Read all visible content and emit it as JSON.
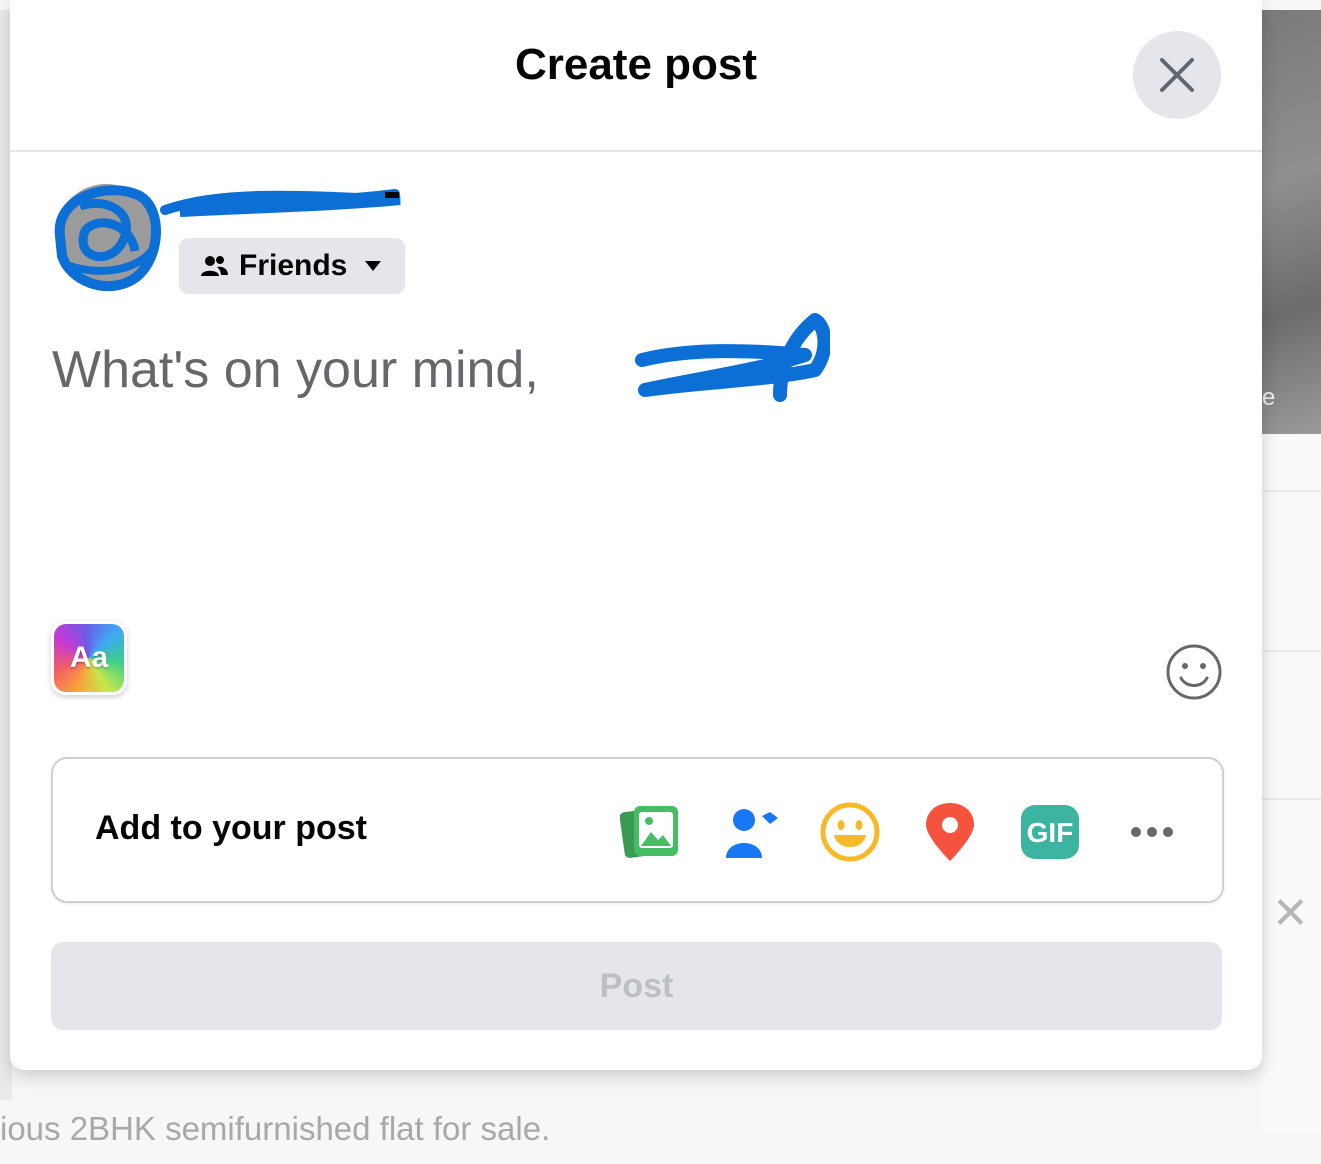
{
  "modal": {
    "title": "Create post",
    "close_label": "Close"
  },
  "user": {
    "audience": "Friends"
  },
  "composer": {
    "placeholder": "What's on your mind,"
  },
  "add_to_post": {
    "label": "Add to your post",
    "icons": [
      "photo-video-icon",
      "tag-people-icon",
      "feeling-activity-icon",
      "check-in-icon",
      "gif-icon",
      "more-icon"
    ]
  },
  "post_button": {
    "label": "Post"
  },
  "text_format": {
    "label": "Aa"
  },
  "background_page": {
    "text": "ious 2BHK semifurnished flat for sale."
  },
  "colors": {
    "accent": "#1877f2",
    "disabled_button": "#e4e6eb",
    "photo_green": "#45bd62",
    "feeling_yellow": "#f7b928",
    "checkin_red": "#f5533d",
    "gif_teal": "#3bb4a1"
  }
}
